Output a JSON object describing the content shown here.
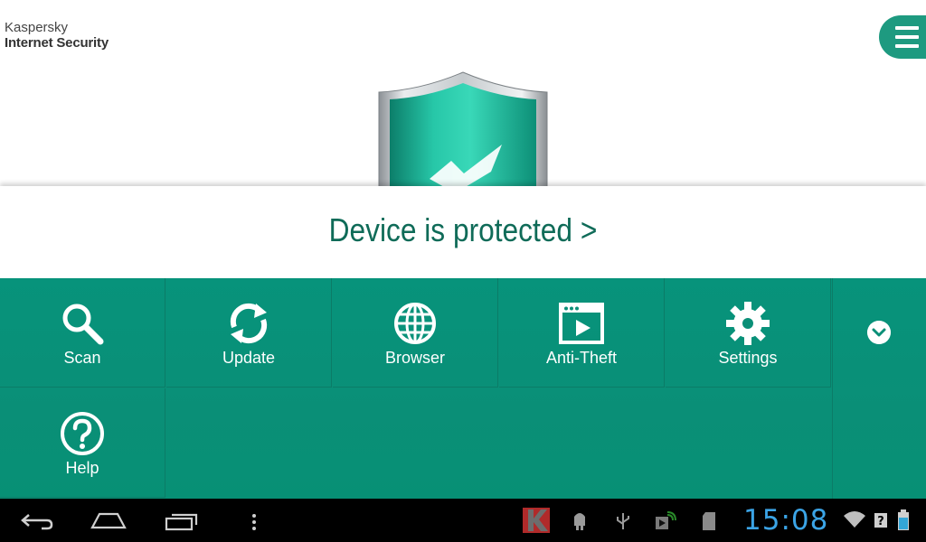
{
  "header": {
    "brand_line1": "Kaspersky",
    "brand_line2": "Internet Security",
    "menu_icon": "hamburger-icon"
  },
  "status": {
    "text": "Device is protected >",
    "icon": "shield-check-icon"
  },
  "tiles": [
    {
      "label": "Scan",
      "icon": "search-icon"
    },
    {
      "label": "Update",
      "icon": "refresh-icon"
    },
    {
      "label": "Browser",
      "icon": "globe-icon"
    },
    {
      "label": "Anti-Theft",
      "icon": "video-window-icon"
    },
    {
      "label": "Settings",
      "icon": "gear-icon"
    },
    {
      "label": "Help",
      "icon": "help-icon"
    }
  ],
  "expand_icon": "chevron-down-icon",
  "system_bar": {
    "time": "15:08",
    "icons": [
      "back-icon",
      "home-icon",
      "recents-icon",
      "overflow-icon",
      "kaspersky-notification-icon",
      "android-debug-icon",
      "usb-icon",
      "media-icon",
      "sdcard-icon",
      "wifi-icon",
      "signal-unknown-icon",
      "battery-icon"
    ]
  },
  "colors": {
    "accent": "#079075",
    "status_text": "#0f6b58",
    "clock": "#3ba4e6"
  }
}
